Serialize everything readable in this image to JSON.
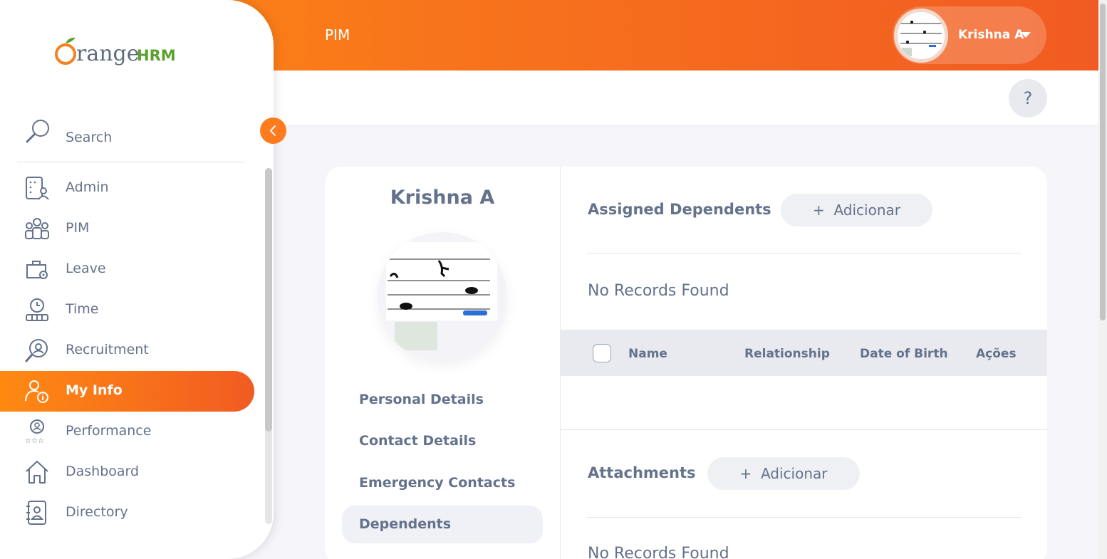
{
  "header": {
    "module_title": "PIM",
    "user_name": "Krishna A"
  },
  "help": {
    "label": "?"
  },
  "sidebar": {
    "search_label": "Search",
    "items": [
      {
        "label": "Admin",
        "icon": "admin-icon"
      },
      {
        "label": "PIM",
        "icon": "pim-icon"
      },
      {
        "label": "Leave",
        "icon": "leave-icon"
      },
      {
        "label": "Time",
        "icon": "time-icon"
      },
      {
        "label": "Recruitment",
        "icon": "recruitment-icon"
      },
      {
        "label": "My Info",
        "icon": "my-info-icon",
        "active": true
      },
      {
        "label": "Performance",
        "icon": "performance-icon"
      },
      {
        "label": "Dashboard",
        "icon": "dashboard-icon"
      },
      {
        "label": "Directory",
        "icon": "directory-icon"
      }
    ]
  },
  "profile": {
    "name": "Krishna A",
    "tabs": [
      "Personal Details",
      "Contact Details",
      "Emergency Contacts",
      "Dependents"
    ],
    "active_tab": "Dependents"
  },
  "dependents": {
    "title": "Assigned Dependents",
    "add_label": "Adicionar",
    "empty_text": "No Records Found",
    "columns": [
      "Name",
      "Relationship",
      "Date of Birth",
      "Ações"
    ]
  },
  "attachments": {
    "title": "Attachments",
    "add_label": "Adicionar",
    "empty_text": "No Records Found"
  },
  "colors": {
    "brand_orange": "#ff8a12",
    "brand_red_orange": "#f15b22",
    "text_muted": "#64728c"
  }
}
